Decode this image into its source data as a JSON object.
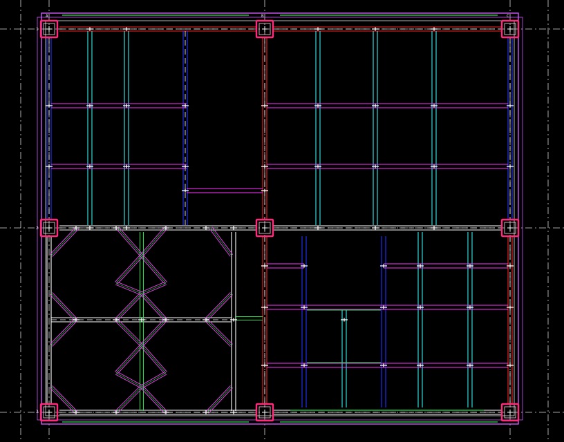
{
  "drawing": {
    "type": "structural-framing-plan",
    "colors": {
      "background": "#000000",
      "axis": "#ffffff",
      "column": "#ff2a7a",
      "column_core": "#ffd7e6",
      "frame_outer": "#d257ff",
      "frame_inner": "#ffffff",
      "frame_green": "#27e34a",
      "beam_red": "#ff2222",
      "beam_magenta": "#ff33ff",
      "beam_cyan": "#33eeee",
      "beam_blue": "#2233ff",
      "beam_green": "#27e34a",
      "beam_white": "#ffffff",
      "brace": "#e040e0",
      "marker": "#ffffff"
    },
    "axis_tags": [
      "A",
      "B",
      "C",
      "1",
      "2",
      "3"
    ]
  }
}
